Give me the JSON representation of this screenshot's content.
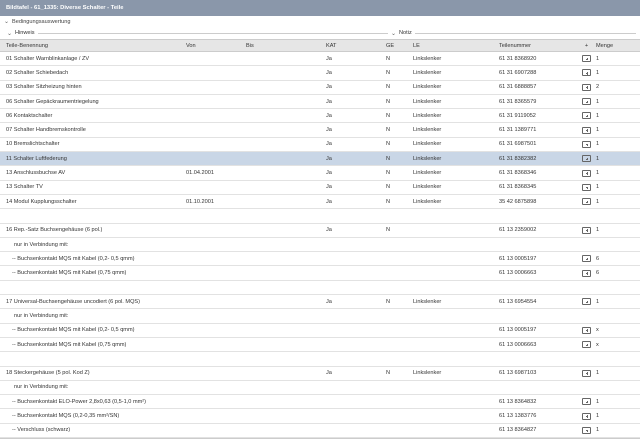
{
  "title": "Bildtafel - 61_1335: Diverse Schalter - Teile",
  "sections": {
    "bedingung": "Bedingungsauswertung",
    "hinweis": "Hinweis",
    "notiz": "Notiz"
  },
  "columns": [
    "Teile-Benennung",
    "Von",
    "Bis",
    "KAT",
    "GE",
    "LE",
    "Teilenummer",
    "+",
    "Menge"
  ],
  "rows": [
    {
      "name": "01 Schalter Warnblinkanlage / ZV",
      "von": "",
      "bis": "",
      "kat": "Ja",
      "ge": "N",
      "le": "Linkslenker",
      "nr": "61 31 8368920",
      "cart": true,
      "menge": "1"
    },
    {
      "name": "02 Schalter Schiebedach",
      "von": "",
      "bis": "",
      "kat": "Ja",
      "ge": "N",
      "le": "Linkslenker",
      "nr": "61 31 6907288",
      "cart": true,
      "menge": "1"
    },
    {
      "name": "03 Schalter Sitzheizung hinten",
      "von": "",
      "bis": "",
      "kat": "Ja",
      "ge": "N",
      "le": "Linkslenker",
      "nr": "61 31 6888857",
      "cart": true,
      "menge": "2"
    },
    {
      "name": "06 Schalter Gepäckraumentriegelung",
      "von": "",
      "bis": "",
      "kat": "Ja",
      "ge": "N",
      "le": "Linkslenker",
      "nr": "61 31 8365579",
      "cart": true,
      "menge": "1"
    },
    {
      "name": "06 Kontaktschalter",
      "von": "",
      "bis": "",
      "kat": "Ja",
      "ge": "N",
      "le": "Linkslenker",
      "nr": "61 31 9119052",
      "cart": true,
      "menge": "1"
    },
    {
      "name": "07 Schalter Handbremskontrolle",
      "von": "",
      "bis": "",
      "kat": "Ja",
      "ge": "N",
      "le": "Linkslenker",
      "nr": "61 31 1389771",
      "cart": true,
      "menge": "1"
    },
    {
      "name": "10 Bremslichtschalter",
      "von": "",
      "bis": "",
      "kat": "Ja",
      "ge": "N",
      "le": "Linkslenker",
      "nr": "61 31 6987501",
      "cart": true,
      "menge": "1"
    },
    {
      "name": "11 Schalter Luftfederung",
      "von": "",
      "bis": "",
      "kat": "Ja",
      "ge": "N",
      "le": "Linkslenker",
      "nr": "61 31 8382382",
      "cart": true,
      "menge": "1",
      "selected": true
    },
    {
      "name": "13 Anschlussbuchse AV",
      "von": "01.04.2001",
      "bis": "",
      "kat": "Ja",
      "ge": "N",
      "le": "Linkslenker",
      "nr": "61 31 8368346",
      "cart": true,
      "menge": "1"
    },
    {
      "name": "13 Schalter TV",
      "von": "",
      "bis": "",
      "kat": "Ja",
      "ge": "N",
      "le": "Linkslenker",
      "nr": "61 31 8368345",
      "cart": true,
      "menge": "1"
    },
    {
      "name": "14 Modul Kupplungsschalter",
      "von": "01.10.2001",
      "bis": "",
      "kat": "Ja",
      "ge": "N",
      "le": "Linkslenker",
      "nr": "35 42 6875898",
      "cart": true,
      "menge": "1"
    },
    {
      "blank": true
    },
    {
      "name": "16 Rep.-Satz Buchsengehäuse (6 pol.)",
      "von": "",
      "bis": "",
      "kat": "Ja",
      "ge": "N",
      "le": "",
      "nr": "61 13 2359002",
      "cart": true,
      "menge": "1"
    },
    {
      "name": "nur in Verbindung mit:",
      "indent": 1,
      "von": "",
      "bis": "",
      "kat": "",
      "ge": "",
      "le": "",
      "nr": "",
      "cart": false,
      "menge": ""
    },
    {
      "name": "-- Buchsenkontakt MQS mit Kabel (0,2- 0,5 qmm)",
      "indent": 2,
      "von": "",
      "bis": "",
      "kat": "",
      "ge": "",
      "le": "",
      "nr": "61 13 0005197",
      "cart": true,
      "menge": "6"
    },
    {
      "name": "-- Buchsenkontakt MQS mit Kabel (0,75 qmm)",
      "indent": 2,
      "von": "",
      "bis": "",
      "kat": "",
      "ge": "",
      "le": "",
      "nr": "61 13 0006663",
      "cart": true,
      "menge": "6"
    },
    {
      "blank": true
    },
    {
      "name": "17 Universal-Buchsengehäuse uncodiert (6 pol. MQS)",
      "von": "",
      "bis": "",
      "kat": "Ja",
      "ge": "N",
      "le": "Linkslenker",
      "nr": "61 13 6954554",
      "cart": true,
      "menge": "1"
    },
    {
      "name": "nur in Verbindung mit:",
      "indent": 1,
      "von": "",
      "bis": "",
      "kat": "",
      "ge": "",
      "le": "",
      "nr": "",
      "cart": false,
      "menge": ""
    },
    {
      "name": "-- Buchsenkontakt MQS mit Kabel (0,2- 0,5 qmm)",
      "indent": 2,
      "von": "",
      "bis": "",
      "kat": "",
      "ge": "",
      "le": "",
      "nr": "61 13 0005197",
      "cart": true,
      "menge": "x"
    },
    {
      "name": "-- Buchsenkontakt MQS mit Kabel (0,75 qmm)",
      "indent": 2,
      "von": "",
      "bis": "",
      "kat": "",
      "ge": "",
      "le": "",
      "nr": "61 13 0006663",
      "cart": true,
      "menge": "x"
    },
    {
      "blank": true
    },
    {
      "name": "18 Steckergehäuse (5 pol. Kod Z)",
      "von": "",
      "bis": "",
      "kat": "Ja",
      "ge": "N",
      "le": "Linkslenker",
      "nr": "61 13 6987103",
      "cart": true,
      "menge": "1"
    },
    {
      "name": "nur in Verbindung mit:",
      "indent": 1,
      "von": "",
      "bis": "",
      "kat": "",
      "ge": "",
      "le": "",
      "nr": "",
      "cart": false,
      "menge": ""
    },
    {
      "name": "-- Buchsenkontakt ELO-Power 2,8x0,63 (0,5-1,0 mm²)",
      "indent": 2,
      "von": "",
      "bis": "",
      "kat": "",
      "ge": "",
      "le": "",
      "nr": "61 13 8364832",
      "cart": true,
      "menge": "1"
    },
    {
      "name": "-- Buchsenkontakt MQS (0,2-0,35 mm²/SN)",
      "indent": 2,
      "von": "",
      "bis": "",
      "kat": "",
      "ge": "",
      "le": "",
      "nr": "61 13 1383776",
      "cart": true,
      "menge": "1"
    },
    {
      "name": "-- Verschluss (schwarz)",
      "indent": 2,
      "von": "",
      "bis": "",
      "kat": "",
      "ge": "",
      "le": "",
      "nr": "61 13 8364827",
      "cart": true,
      "menge": "1"
    }
  ]
}
